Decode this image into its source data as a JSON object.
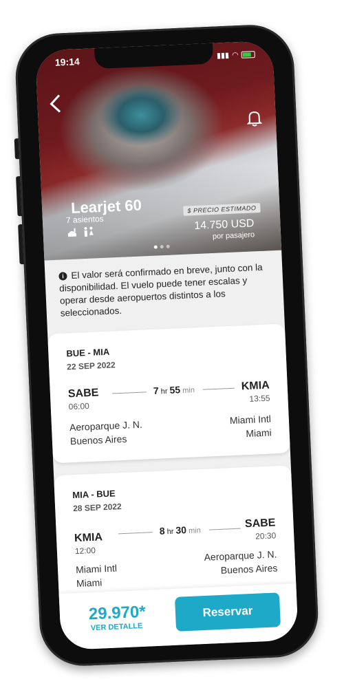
{
  "status": {
    "time": "19:14"
  },
  "aircraft": {
    "name": "Learjet 60",
    "seats": "7 asientos",
    "price_badge": "$ PRECIO ESTIMADO",
    "price": "14.750 USD",
    "price_unit": "por pasajero"
  },
  "info_text": "El valor será confirmado en breve, junto con la disponibilidad. El vuelo puede tener escalas y operar desde aeropuertos distintos a los seleccionados.",
  "flights": [
    {
      "route": "BUE - MIA",
      "date": "22 SEP 2022",
      "origin_code": "SABE",
      "origin_time": "06:00",
      "dest_code": "KMIA",
      "dest_time": "13:55",
      "dur_h": "7",
      "dur_h_unit": "hr",
      "dur_m": "55",
      "dur_m_unit": "min",
      "origin_name": "Aeroparque J. N.",
      "origin_city": "Buenos Aires",
      "dest_name": "Miami Intl",
      "dest_city": "Miami"
    },
    {
      "route": "MIA - BUE",
      "date": "28 SEP 2022",
      "origin_code": "KMIA",
      "origin_time": "12:00",
      "dest_code": "SABE",
      "dest_time": "20:30",
      "dur_h": "8",
      "dur_h_unit": "hr",
      "dur_m": "30",
      "dur_m_unit": "min",
      "origin_name": "Miami Intl",
      "origin_city": "Miami",
      "dest_name": "Aeroparque J. N.",
      "dest_city": "Buenos Aires"
    }
  ],
  "footer": {
    "total": "29.970*",
    "detail": "VER DETALLE",
    "reserve": "Reservar"
  },
  "colors": {
    "accent": "#1fa9c8"
  }
}
